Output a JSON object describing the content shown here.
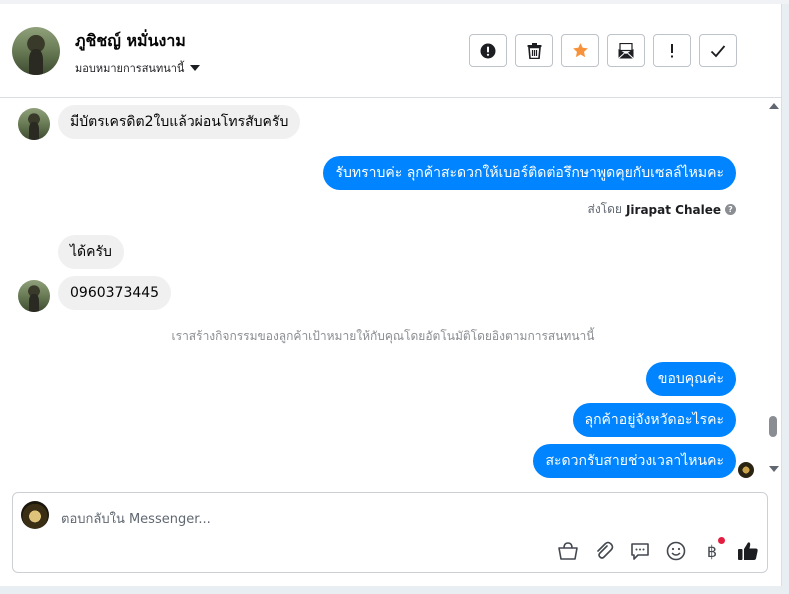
{
  "header": {
    "contact_name": "ภูชิชญ์ หมั่นงาม",
    "assign_label": "มอบหมายการสนทนานี้"
  },
  "toolbar": {
    "buttons": [
      {
        "name": "mark-spam-button",
        "icon": "exclamation-circle-icon"
      },
      {
        "name": "delete-button",
        "icon": "trash-icon"
      },
      {
        "name": "star-button",
        "icon": "star-icon",
        "color": "#f7923a"
      },
      {
        "name": "mark-unread-button",
        "icon": "envelope-icon"
      },
      {
        "name": "follow-up-button",
        "icon": "exclamation-icon"
      },
      {
        "name": "mark-done-button",
        "icon": "check-icon"
      }
    ]
  },
  "messages": [
    {
      "from": "customer",
      "text": "มีบัตรเครดิต2ใบแล้วผ่อนโทรสับครับ"
    },
    {
      "from": "page",
      "text": "รับทราบค่ะ ลุกค้าสะดวกให้เบอร์ติดต่อรึกษาพูดคุยกับเซลล์ไหมคะ"
    },
    {
      "from": "customer",
      "text": "ได้ครับ"
    },
    {
      "from": "customer",
      "text": "0960373445"
    },
    {
      "from": "page",
      "text": "ขอบคุณค่ะ"
    },
    {
      "from": "page",
      "text": "ลุกค้าอยู่จังหวัดอะไรคะ"
    },
    {
      "from": "page",
      "text": "สะดวกรับสายช่วงเวลาไหนคะ"
    }
  ],
  "sent_by": {
    "prefix": "ส่งโดย",
    "name": "Jirapat Chalee"
  },
  "system_note": "เราสร้างกิจกรรมของลูกค้าเป้าหมายให้กับคุณโดยอัตโนมัติโดยอิงตามการสนทนานี้",
  "composer": {
    "placeholder": "ตอบกลับใน Messenger...",
    "icons": [
      "shopping-basket-icon",
      "paperclip-icon",
      "saved-reply-icon",
      "emoji-icon",
      "baht-payment-icon",
      "thumbs-up-icon"
    ],
    "baht_symbol": "฿"
  },
  "colors": {
    "outgoing_bubble": "#0084ff",
    "incoming_bubble": "#f0f0f0",
    "star": "#f7923a"
  }
}
